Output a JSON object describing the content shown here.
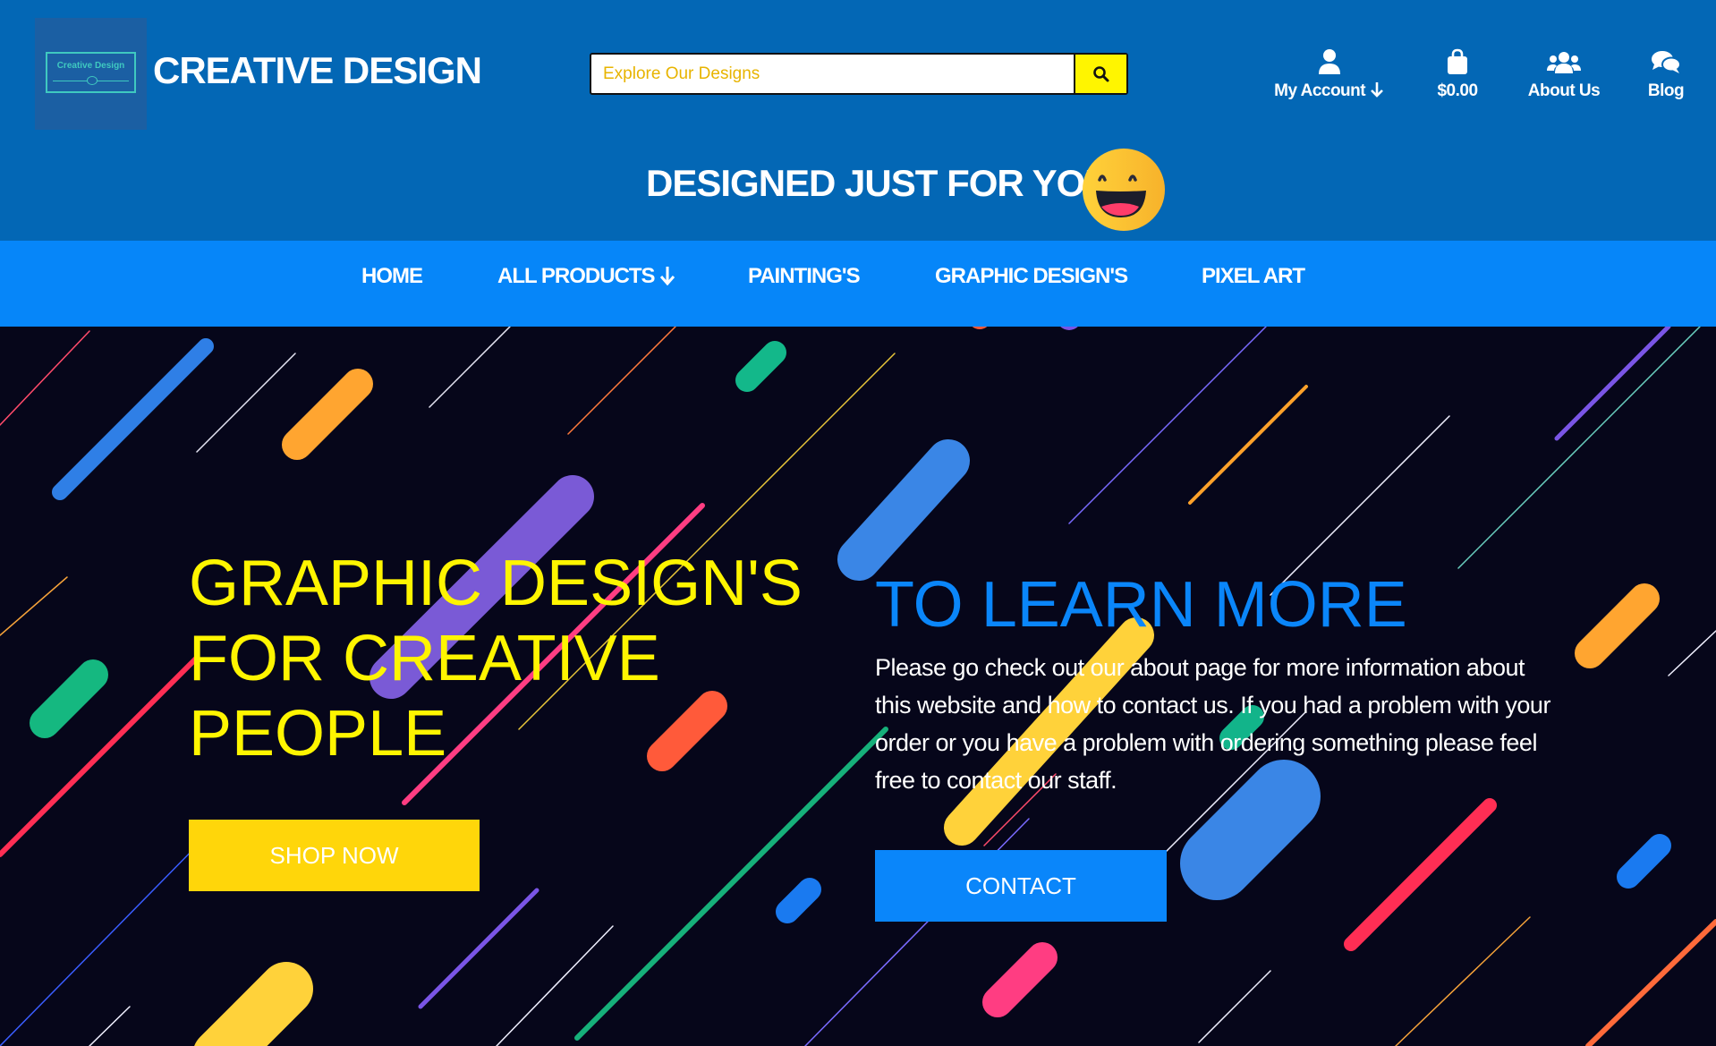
{
  "header": {
    "logo_text": "Creative Design",
    "brand": "CREATIVE DESIGN",
    "search_placeholder": "Explore Our Designs",
    "nav": [
      {
        "label": "My Account",
        "icon": "user-icon"
      },
      {
        "label": "$0.00",
        "icon": "shopping-bag-icon"
      },
      {
        "label": "About Us",
        "icon": "users-icon"
      },
      {
        "label": "Blog",
        "icon": "comments-icon"
      }
    ],
    "tagline": "DESIGNED JUST FOR YOU"
  },
  "menu": {
    "items": [
      "HOME",
      "ALL PRODUCTS",
      "PAINTING'S",
      "GRAPHIC DESIGN'S",
      "PIXEL ART"
    ]
  },
  "hero": {
    "title_lines": [
      "GRAPHIC DESIGN'S",
      "FOR CREATIVE",
      "PEOPLE"
    ],
    "shop_button": "SHOP NOW",
    "learn_title": "TO LEARN MORE",
    "learn_text": "Please go check out our about page for more information about this website and how to contact us. If you had a problem with your order or you have a problem with ordering something please feel free to contact our staff.",
    "contact_button": "CONTACT"
  },
  "colors": {
    "header_bg": "#0367b5",
    "menu_bg": "#0686f9",
    "hero_bg": "#06061a",
    "accent_yellow": "#fff500",
    "accent_blue": "#0a86fa"
  }
}
